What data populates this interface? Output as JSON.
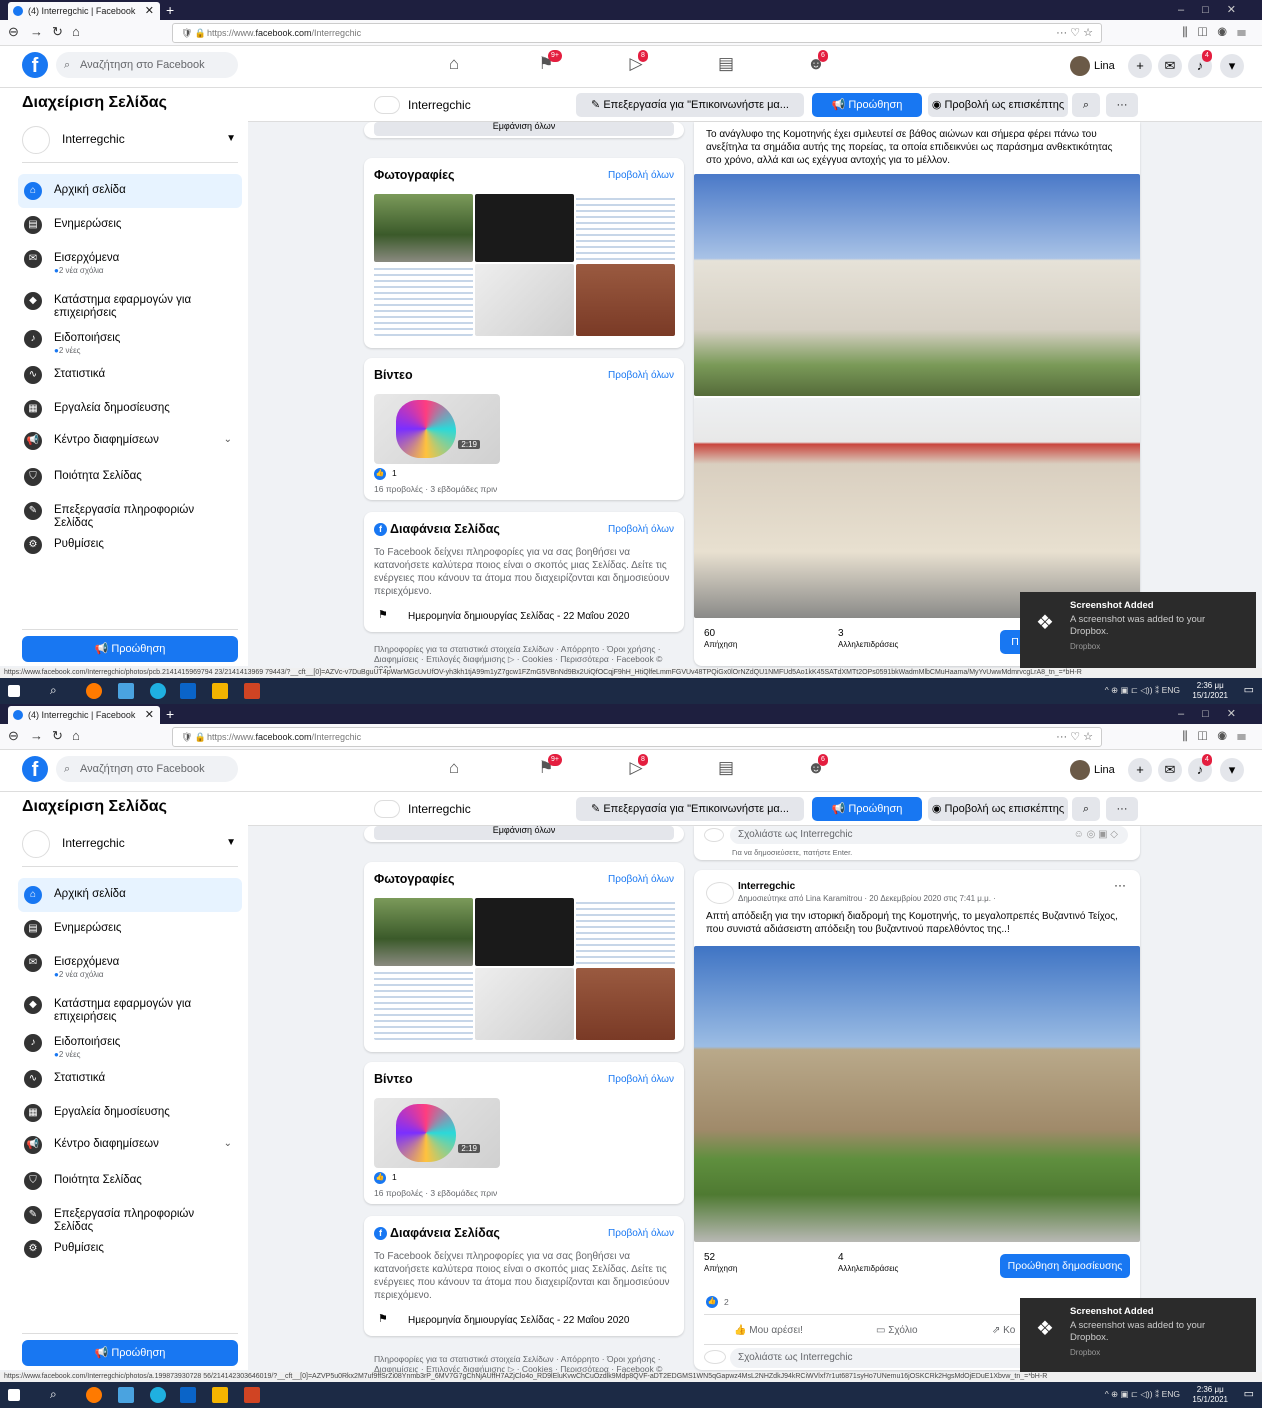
{
  "browser": {
    "tab_title": "(4) Interregchic | Facebook",
    "url_prefix": "https://www.",
    "url_domain": "facebook.com",
    "url_path": "/Interregchic",
    "toolbar_icons": [
      "back-icon",
      "forward-icon",
      "reload-icon",
      "home-icon"
    ]
  },
  "facebook": {
    "search_placeholder": "Αναζήτηση στο Facebook",
    "nav_badges": {
      "pages": "9+",
      "watch": "8",
      "groups": "6",
      "notifications": "4"
    },
    "user_name": "Lina"
  },
  "sidebar": {
    "title": "Διαχείριση Σελίδας",
    "page_name": "Interregchic",
    "items": [
      {
        "label": "Αρχική σελίδα",
        "sub": "",
        "icon": "home-icon",
        "active": true
      },
      {
        "label": "Ενημερώσεις",
        "sub": "",
        "icon": "updates-icon"
      },
      {
        "label": "Εισερχόμενα",
        "sub": "2 νέα σχόλια",
        "icon": "inbox-icon"
      },
      {
        "label": "Κατάστημα εφαρμογών για επιχειρήσεις",
        "sub": "",
        "icon": "store-icon"
      },
      {
        "label": "Ειδοποιήσεις",
        "sub": "2 νέες",
        "icon": "bell-icon"
      },
      {
        "label": "Στατιστικά",
        "sub": "",
        "icon": "insights-icon"
      },
      {
        "label": "Εργαλεία δημοσίευσης",
        "sub": "",
        "icon": "publishing-tools-icon"
      },
      {
        "label": "Κέντρο διαφημίσεων",
        "sub": "",
        "icon": "megaphone-icon"
      },
      {
        "label": "Ποιότητα Σελίδας",
        "sub": "",
        "icon": "shield-icon"
      },
      {
        "label": "Επεξεργασία πληροφοριών Σελίδας",
        "sub": "",
        "icon": "pencil-icon"
      },
      {
        "label": "Ρυθμίσεις",
        "sub": "",
        "icon": "gear-icon"
      }
    ],
    "promote": "Προώθηση"
  },
  "page_bar": {
    "page_name": "Interregchic",
    "edit_button": "Επεξεργασία για \"Επικοινωνήστε μα...",
    "promote_button": "Προώθηση",
    "visitor_button": "Προβολή ως επισκέπτης"
  },
  "left_column": {
    "see_all_cut": "Εμφάνιση όλων",
    "photos_title": "Φωτογραφίες",
    "see_all": "Προβολή όλων",
    "videos_title": "Βίντεο",
    "video_duration": "2:19",
    "video_likes": "1",
    "video_meta": "16 προβολές · 3 εβδομάδες πριν",
    "transparency_title": "Διαφάνεια Σελίδας",
    "transparency_text": "Το Facebook δείχνει πληροφορίες για να σας βοηθήσει να κατανοήσετε καλύτερα ποιος είναι ο σκοπός μιας Σελίδας. Δείτε τις ενέργειες που κάνουν τα άτομα που διαχειρίζονται και δημοσιεύουν περιεχόμενο.",
    "creation_date": "Ημερομηνία δημιουργίας Σελίδας - 22 Μαΐου 2020",
    "footer_line1": "Πληροφορίες για τα στατιστικά στοιχεία Σελίδων · Απόρρητο · Όροι χρήσης ·",
    "footer_line2": "Διαφημίσεις · Επιλογές διαφήμισης ▷ · Cookies · Περισσότερα · Facebook © 2021"
  },
  "shot1": {
    "post_text": "Το ανάγλυφο της Κομοτηνής έχει σμιλευτεί σε βάθος αιώνων και σήμερα φέρει πάνω του ανεξίτηλα τα σημάδια αυτής της πορείας, τα οποία επιδεικνύει ως παράσημα ανθεκτικότητας στο χρόνο, αλλά και ως εχέγγυα αντοχής για το μέλλον.",
    "reach_value": "60",
    "reach_label": "Απήχηση",
    "engagement_value": "3",
    "engagement_label": "Αλληλεπιδράσεις",
    "promote_cut": "Π",
    "status_url": "https://www.facebook.com/Interregchic/photos/pcb.2141415969794 23/2141413969 79443/?__cft__[0]=AZVc-v7DuBguUT4pWarMGcUvUfOV-yh3kh1tjA99m1yZ7gcw1FZmG5VBnNd9Bx2UiQfOCqjF9hH_HtiQlfeLmmFGVUv48TPQiGx0lOrNZdQU1NMFUd5Ao1kK45SATdXMTt2OPs0591bkWadmMlbCMuHaama/MyYvUwwMdmrvcgLrA8_tn_=*bH-R",
    "time": "2:36 μμ",
    "date": "15/1/2021"
  },
  "shot2": {
    "comment_placeholder": "Σχολιάστε ως Interregchic",
    "enter_hint": "Για να δημοσιεύσετε, πατήστε Enter.",
    "post_author": "Interregchic",
    "post_meta": "Δημοσιεύτηκε από Lina Karamitrou · 20 Δεκεμβρίου 2020 στις 7:41 μ.μ. ·",
    "post_text": "Απτή απόδειξη για την ιστορική διαδρομή της Κομοτηνής, το μεγαλοπρεπές Βυζαντινό Τείχος, που συνιστά αδιάσειστη απόδειξη του βυζαντινού παρελθόντος της..!",
    "reach_value": "52",
    "reach_label": "Απήχηση",
    "engagement_value": "4",
    "engagement_label": "Αλληλεπιδράσεις",
    "promote_post": "Προώθηση δημοσίευσης",
    "likes": "2",
    "like_action": "Μου αρέσει!",
    "comment_action": "Σχόλιο",
    "share_cut": "Κο",
    "status_url": "https://www.facebook.com/Interregchic/photos/a.199873930728 56/214142303646019/?__cft__[0]=AZVP5u0Rkx2M7uf9ffSrZi08Ynmb3rP_6MV7G7gChNjAUffH7AZjClo4o_RD9lEluKvwChCuOzdlk9Mdp8QVF-aDT2EDGMS1WN5qGapwz4MsL2NHZdkJ94kRCiWVlxf7r1ut6871syHo7UNemu16jOSKCRk2HgsMdOjEDuE1Xbvw_tn_=*bH-R",
    "time": "2:36 μμ",
    "date": "15/1/2021"
  },
  "toast": {
    "title": "Screenshot Added",
    "text": "A screenshot was added to your Dropbox.",
    "app": "Dropbox"
  },
  "taskbar": {
    "lang": "ENG",
    "tray_icons": [
      "chevron-up-icon",
      "dropbox-tray-icon",
      "network-icon",
      "volume-icon",
      "bluetooth-icon"
    ]
  },
  "colors": {
    "accent": "#1877f2",
    "badge": "#e41e3f",
    "taskbar": "#1c2a45",
    "tabbar": "#1e1f3f"
  }
}
